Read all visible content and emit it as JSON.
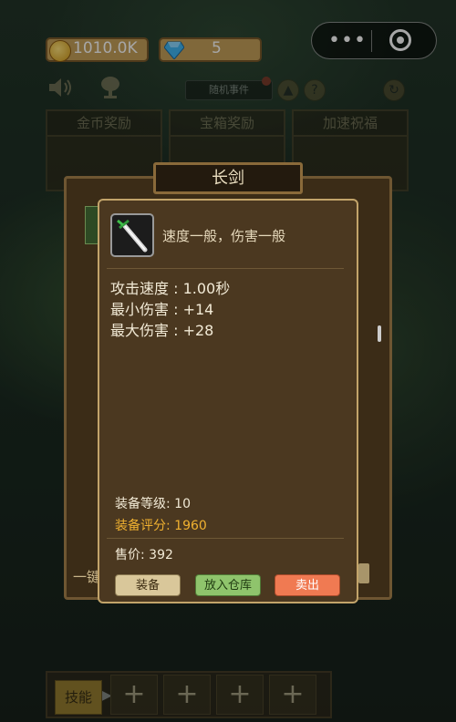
{
  "top_bar": {
    "coins": "1010.0K",
    "gems": "5",
    "coin_icon": "gold-coin-icon",
    "gem_icon": "diamond-icon"
  },
  "toolbar": {
    "event_button": "随机事件",
    "help_glyph": "?",
    "up_glyph": "▲",
    "refresh_glyph": "↻"
  },
  "reward_tabs": [
    "金币奖励",
    "宝箱奖励",
    "加速祝福"
  ],
  "dialog": {
    "title": "长剑",
    "item_icon": "sword-icon",
    "description": "速度一般，伤害一般",
    "stats": [
      "攻击速度 : 1.00秒",
      "最小伤害 : +14",
      "最大伤害 : +28"
    ],
    "equip_level": "装备等级: 10",
    "equip_score": "装备评分: 1960",
    "price": "售价:  392",
    "buttons": {
      "equip": "装备",
      "store": "放入仓库",
      "sell": "卖出"
    }
  },
  "background": {
    "side_label": "一键"
  },
  "skill_bar": {
    "skill_label": "技能",
    "arrow": "▶",
    "slots": [
      "+",
      "+",
      "+",
      "+"
    ]
  },
  "colors": {
    "score": "#f0b130",
    "btn_equip": "#d9c79a",
    "btn_store": "#8fc46c",
    "btn_sell": "#f07a52"
  }
}
